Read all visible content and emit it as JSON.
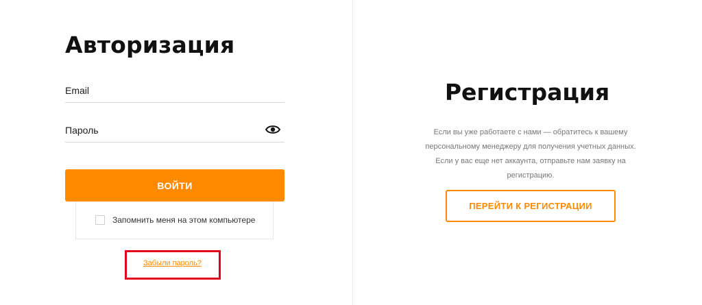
{
  "login": {
    "title": "Авторизация",
    "email_placeholder": "Email",
    "password_placeholder": "Пароль",
    "submit_label": "ВОЙТИ",
    "remember_label": "Запомнить меня на этом компьютере",
    "remember_checked": false,
    "forgot_label": "Забыли пароль?"
  },
  "registration": {
    "title": "Регистрация",
    "description": "Если вы уже работаете с нами — обратитесь к вашему персональному менеджеру для получения учетных данных. Если у вас еще нет аккаунта, отправьте нам заявку на регистрацию.",
    "button_label": "ПЕРЕЙТИ К РЕГИСТРАЦИИ"
  },
  "colors": {
    "accent": "#ff8a00",
    "highlight": "#e3001b",
    "text_muted": "#777777"
  },
  "icons": {
    "password_toggle": "eye-icon"
  }
}
